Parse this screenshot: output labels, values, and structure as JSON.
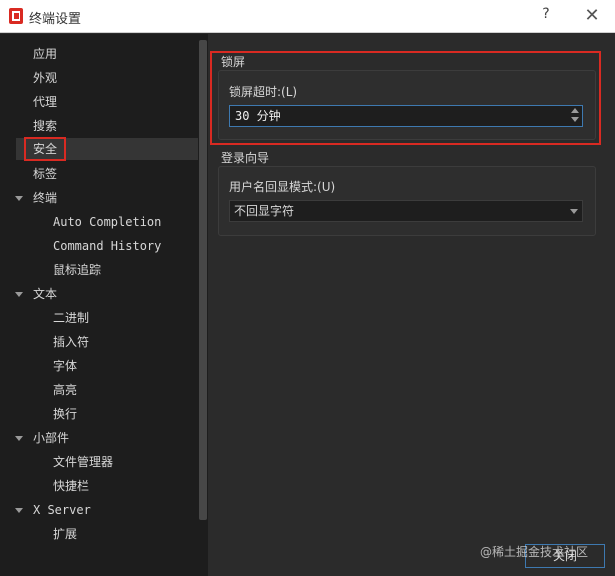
{
  "window": {
    "title": "终端设置",
    "help_glyph": "?",
    "close_glyph": "✕",
    "icon": "app-icon",
    "accent_color": "#d92a22"
  },
  "sidebar": {
    "items": [
      {
        "label": "应用"
      },
      {
        "label": "外观"
      },
      {
        "label": "代理"
      },
      {
        "label": "搜索"
      },
      {
        "label": "安全",
        "selected": true
      },
      {
        "label": "标签"
      },
      {
        "label": "终端",
        "expanded": true
      },
      {
        "label": "Auto Completion"
      },
      {
        "label": "Command History"
      },
      {
        "label": "鼠标追踪"
      },
      {
        "label": "文本",
        "expanded": true
      },
      {
        "label": "二进制"
      },
      {
        "label": "插入符"
      },
      {
        "label": "字体"
      },
      {
        "label": "高亮"
      },
      {
        "label": "换行"
      },
      {
        "label": "小部件",
        "expanded": true
      },
      {
        "label": "文件管理器"
      },
      {
        "label": "快捷栏"
      },
      {
        "label": "X Server",
        "expanded": true
      },
      {
        "label": "扩展"
      }
    ]
  },
  "lock_screen": {
    "group_title": "锁屏",
    "timeout_label": "锁屏超时:(L)",
    "timeout_value": "30 分钟"
  },
  "login_wizard": {
    "group_title": "登录向导",
    "echo_label": "用户名回显模式:(U)",
    "echo_value": "不回显字符"
  },
  "footer": {
    "close_label": "关闭",
    "watermark": "@稀土掘金技术社区"
  }
}
